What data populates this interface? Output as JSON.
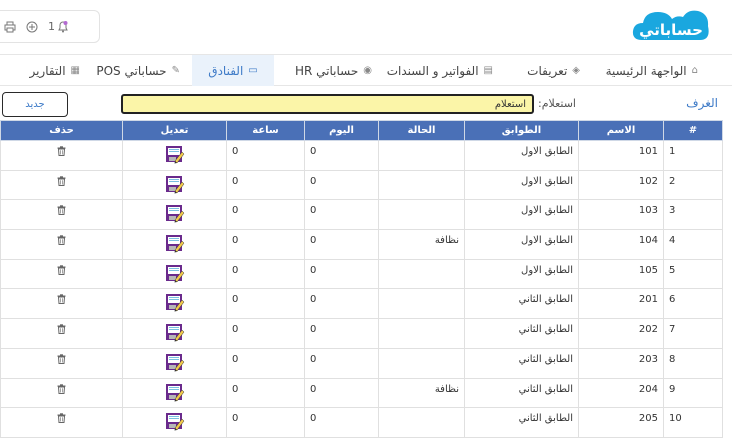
{
  "topbar": {
    "tools": [
      {
        "icon": "bell-icon",
        "count": "1"
      },
      {
        "icon": "plus-circle-icon"
      },
      {
        "icon": "printer-icon"
      }
    ],
    "logo_text": "حساباتي"
  },
  "menu": [
    {
      "label": "الواجهة الرئيسية",
      "icon": "home-icon"
    },
    {
      "label": "تعريفات",
      "icon": "definitions-icon"
    },
    {
      "label": "الفواتير و السندات",
      "icon": "invoice-icon"
    },
    {
      "label": "حساباتي HR",
      "icon": "hr-icon"
    },
    {
      "label": "الفنادق",
      "icon": "hotel-icon",
      "active": true
    },
    {
      "label": "حساباتي POS",
      "icon": "pos-icon"
    },
    {
      "label": "التقارير",
      "icon": "reports-icon"
    }
  ],
  "page": {
    "title": "الغرف",
    "search_label": "استعلام:",
    "search_value": "استعلام",
    "new_button": "جديد"
  },
  "table": {
    "headers": {
      "num": "#",
      "name": "الاسم",
      "floor": "الطوابق",
      "status": "الحالة",
      "day": "اليوم",
      "hour": "ساعة",
      "edit": "تعديل",
      "delete": "حذف"
    },
    "rows": [
      {
        "num": "1",
        "name": "101",
        "floor": "الطابق الاول",
        "status": "",
        "day": "0",
        "hour": "0"
      },
      {
        "num": "2",
        "name": "102",
        "floor": "الطابق الاول",
        "status": "",
        "day": "0",
        "hour": "0"
      },
      {
        "num": "3",
        "name": "103",
        "floor": "الطابق الاول",
        "status": "",
        "day": "0",
        "hour": "0"
      },
      {
        "num": "4",
        "name": "104",
        "floor": "الطابق الاول",
        "status": "نظافة",
        "day": "0",
        "hour": "0"
      },
      {
        "num": "5",
        "name": "105",
        "floor": "الطابق الاول",
        "status": "",
        "day": "0",
        "hour": "0"
      },
      {
        "num": "6",
        "name": "201",
        "floor": "الطابق الثاني",
        "status": "",
        "day": "0",
        "hour": "0"
      },
      {
        "num": "7",
        "name": "202",
        "floor": "الطابق الثاني",
        "status": "",
        "day": "0",
        "hour": "0"
      },
      {
        "num": "8",
        "name": "203",
        "floor": "الطابق الثاني",
        "status": "",
        "day": "0",
        "hour": "0"
      },
      {
        "num": "9",
        "name": "204",
        "floor": "الطابق الثاني",
        "status": "نظافة",
        "day": "0",
        "hour": "0"
      },
      {
        "num": "10",
        "name": "205",
        "floor": "الطابق الثاني",
        "status": "",
        "day": "0",
        "hour": "0"
      }
    ]
  },
  "colors": {
    "accent": "#3d7ac7",
    "header_bg": "#4a70b7",
    "search_bg": "#fbf5a8",
    "logo_blue": "#1aa7df",
    "edit_purple": "#6a2a8c"
  }
}
